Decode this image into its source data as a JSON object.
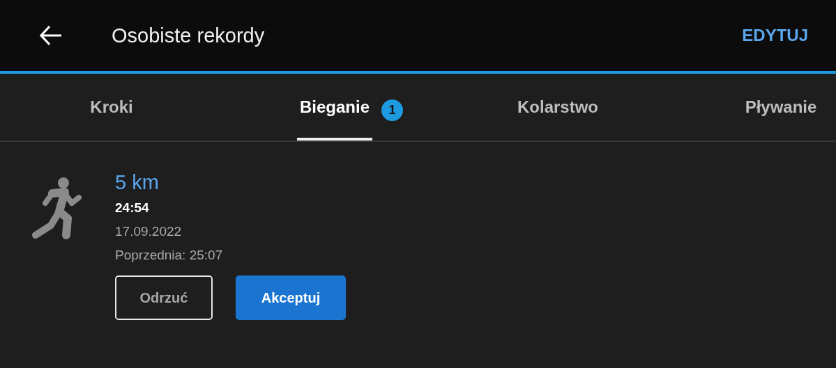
{
  "header": {
    "title": "Osobiste rekordy",
    "action": "EDYTUJ"
  },
  "tabs": [
    {
      "label": "Kroki",
      "selected": false
    },
    {
      "label": "Bieganie",
      "selected": true,
      "badge": "1"
    },
    {
      "label": "Kolarstwo",
      "selected": false
    },
    {
      "label": "Pływanie",
      "selected": false
    }
  ],
  "records": [
    {
      "distance": "5 km",
      "time": "24:54",
      "date": "17.09.2022",
      "previous": "Poprzednia: 25:07",
      "buttons": [
        {
          "label": "Odrzuć",
          "kind": "outline"
        },
        {
          "label": "Akceptuj",
          "kind": "primary"
        }
      ]
    }
  ]
}
